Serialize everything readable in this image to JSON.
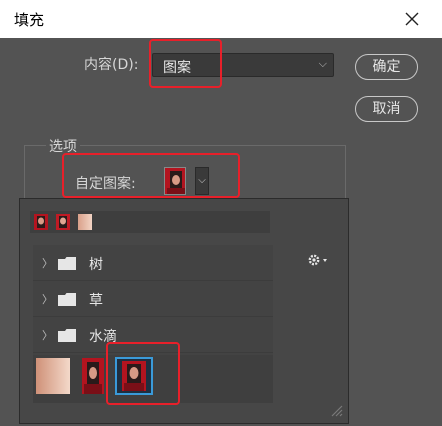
{
  "dialog": {
    "title": "填充"
  },
  "contents": {
    "label": "内容(D):",
    "value": "图案"
  },
  "buttons": {
    "ok": "确定",
    "cancel": "取消"
  },
  "options": {
    "legend": "选项",
    "custom_pattern_label": "自定图案:"
  },
  "picker": {
    "folders": [
      {
        "name": "树"
      },
      {
        "name": "草"
      },
      {
        "name": "水滴"
      }
    ],
    "recent_patterns": [
      "portrait-red",
      "portrait-red-small",
      "skin-peach"
    ],
    "patterns": [
      "skin-peach",
      "portrait-red",
      "portrait-red-selected"
    ],
    "selected_index": 2
  },
  "colors": {
    "highlight": "#e8202a",
    "selection": "#3a9ad9"
  }
}
